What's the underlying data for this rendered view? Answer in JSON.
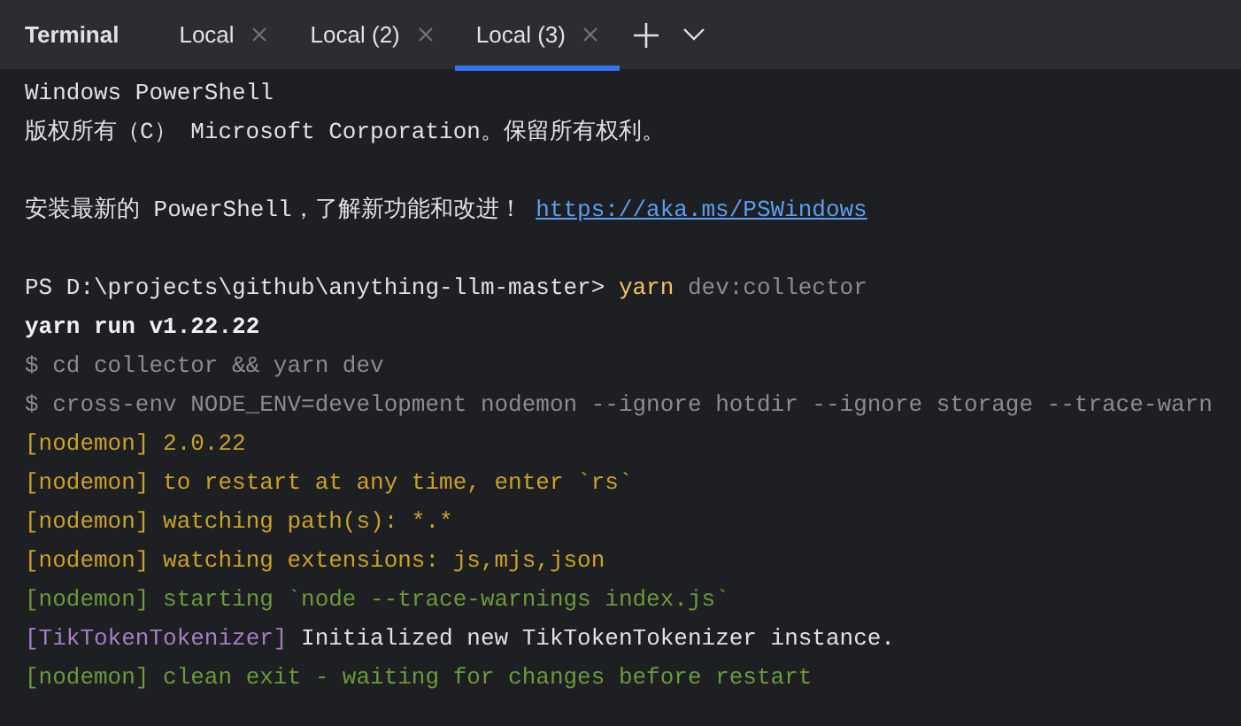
{
  "panel": {
    "title": "Terminal"
  },
  "tabs": [
    {
      "label": "Local",
      "selected": false
    },
    {
      "label": "Local (2)",
      "selected": false
    },
    {
      "label": "Local (3)",
      "selected": true
    }
  ],
  "lines": [
    {
      "kind": "text",
      "segments": [
        {
          "kind": "plain",
          "text": "Windows PowerShell"
        }
      ]
    },
    {
      "kind": "text",
      "segments": [
        {
          "kind": "plain",
          "text": "版权所有（C） Microsoft Corporation。保留所有权利。"
        }
      ]
    },
    {
      "kind": "blank"
    },
    {
      "kind": "text",
      "segments": [
        {
          "kind": "plain",
          "text": "安装最新的 PowerShell，了解新功能和改进！"
        },
        {
          "kind": "link",
          "text": "https://aka.ms/PSWindows"
        }
      ]
    },
    {
      "kind": "blank"
    },
    {
      "kind": "text",
      "segments": [
        {
          "kind": "plain",
          "text": "PS D:\\projects\\github\\anything-llm-master>"
        },
        {
          "kind": "command",
          "text": "yarn"
        },
        {
          "kind": "dim",
          "text": "dev:collector"
        }
      ]
    },
    {
      "kind": "text",
      "segments": [
        {
          "kind": "bold",
          "text": "yarn run v1.22.22"
        }
      ]
    },
    {
      "kind": "text",
      "segments": [
        {
          "kind": "dim",
          "text": "$ cd collector && yarn dev"
        }
      ]
    },
    {
      "kind": "text",
      "segments": [
        {
          "kind": "dim",
          "text": "$ cross-env NODE_ENV=development nodemon --ignore hotdir --ignore storage --trace-warn"
        }
      ]
    },
    {
      "kind": "text",
      "segments": [
        {
          "kind": "yellow",
          "text": "[nodemon] 2.0.22"
        }
      ]
    },
    {
      "kind": "text",
      "segments": [
        {
          "kind": "yellow",
          "text": "[nodemon] to restart at any time, enter `rs`"
        }
      ]
    },
    {
      "kind": "text",
      "segments": [
        {
          "kind": "yellow",
          "text": "[nodemon] watching path(s): *.*"
        }
      ]
    },
    {
      "kind": "text",
      "segments": [
        {
          "kind": "yellow",
          "text": "[nodemon] watching extensions: js,mjs,json"
        }
      ]
    },
    {
      "kind": "text",
      "segments": [
        {
          "kind": "green",
          "text": "[nodemon] starting `node --trace-warnings index.js`"
        }
      ]
    },
    {
      "kind": "text",
      "segments": [
        {
          "kind": "purple",
          "text": "[TikTokenTokenizer]"
        },
        {
          "kind": "plain",
          "text": "Initialized new TikTokenTokenizer instance."
        }
      ]
    },
    {
      "kind": "text",
      "segments": [
        {
          "kind": "green",
          "text": "[nodemon] clean exit - waiting for changes before restart"
        }
      ]
    }
  ]
}
